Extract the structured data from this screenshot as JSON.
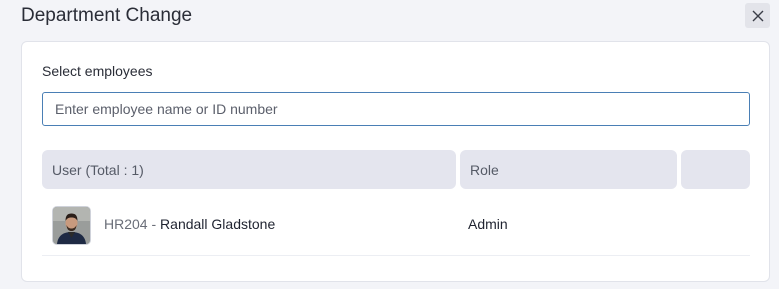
{
  "dialog": {
    "title": "Department Change",
    "close_icon": "close-icon"
  },
  "form": {
    "select_label": "Select employees",
    "search_placeholder": "Enter employee name or ID number",
    "search_value": ""
  },
  "table": {
    "columns": [
      "User (Total : 1)",
      "Role",
      ""
    ],
    "rows": [
      {
        "avatar": "avatar-icon",
        "employee_id": "HR204",
        "separator": "-",
        "name": "Randall Gladstone",
        "role": "Admin"
      }
    ]
  },
  "colors": {
    "background": "#f3f4f8",
    "header_cell": "#e4e5ee",
    "input_border": "#4a7fb5"
  }
}
